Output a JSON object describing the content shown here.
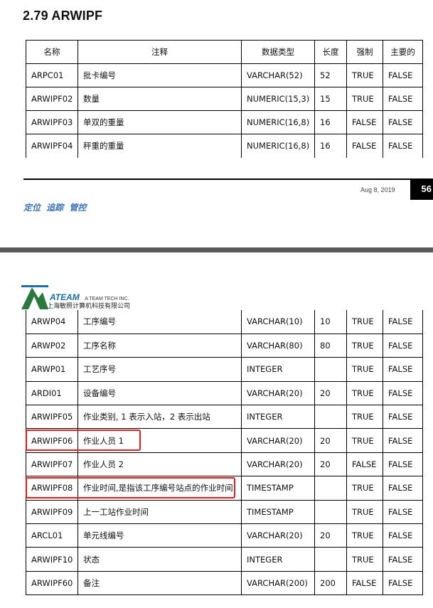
{
  "section_title": "2.79 ARWIPF",
  "columns": [
    "名称",
    "注释",
    "数据类型",
    "长度",
    "强制",
    "主要的"
  ],
  "table_top_rows": [
    [
      "ARPC01",
      "批卡编号",
      "VARCHAR(52)",
      "52",
      "TRUE",
      "FALSE"
    ],
    [
      "ARWIPF02",
      "数量",
      "NUMERIC(15,3)",
      "15",
      "TRUE",
      "FALSE"
    ],
    [
      "ARWIPF03",
      "单双的重量",
      "NUMERIC(16,8)",
      "16",
      "FALSE",
      "FALSE"
    ],
    [
      "ARWIPF04",
      "秤重的重量",
      "NUMERIC(16,8)",
      "16",
      "FALSE",
      "FALSE"
    ]
  ],
  "footer": {
    "date": "Aug 8, 2019",
    "page": "56",
    "slogan": "定位 追踪 管控"
  },
  "brand": {
    "name": "ATEAM",
    "tagline": "A TEAM TECH INC.",
    "cn_name": "上海敏照计算机科技有限公司"
  },
  "table_bottom_rows": [
    [
      "ARWP04",
      "工序编号",
      "VARCHAR(10)",
      "10",
      "TRUE",
      "FALSE"
    ],
    [
      "ARWP02",
      "工序名称",
      "VARCHAR(80)",
      "80",
      "TRUE",
      "FALSE"
    ],
    [
      "ARWP01",
      "工艺序号",
      "INTEGER",
      "",
      "TRUE",
      "FALSE"
    ],
    [
      "ARDI01",
      "设备编号",
      "VARCHAR(20)",
      "20",
      "TRUE",
      "FALSE"
    ],
    [
      "ARWIPF05",
      "作业类别, 1 表示入站，2 表示出站",
      "INTEGER",
      "",
      "TRUE",
      "FALSE"
    ],
    [
      "ARWIPF06",
      "作业人员 1",
      "VARCHAR(20)",
      "20",
      "TRUE",
      "FALSE"
    ],
    [
      "ARWIPF07",
      "作业人员 2",
      "VARCHAR(20)",
      "20",
      "FALSE",
      "FALSE"
    ],
    [
      "ARWIPF08",
      "作业时间,是指该工序编号站点的作业时间",
      "TIMESTAMP",
      "",
      "TRUE",
      "FALSE"
    ],
    [
      "ARWIPF09",
      "上一工站作业时间",
      "TIMESTAMP",
      "",
      "TRUE",
      "FALSE"
    ],
    [
      "ARCL01",
      "单元线编号",
      "VARCHAR(20)",
      "20",
      "TRUE",
      "FALSE"
    ],
    [
      "ARWIPF10",
      "状态",
      "INTEGER",
      "",
      "TRUE",
      "FALSE"
    ],
    [
      "ARWIPF60",
      "备注",
      "VARCHAR(200)",
      "200",
      "FALSE",
      "FALSE"
    ]
  ],
  "colors": {
    "highlight": "#e01b1b",
    "slogan": "#3b74b8",
    "brand": "#1a6fa8",
    "separator": "#5a5a5a"
  }
}
